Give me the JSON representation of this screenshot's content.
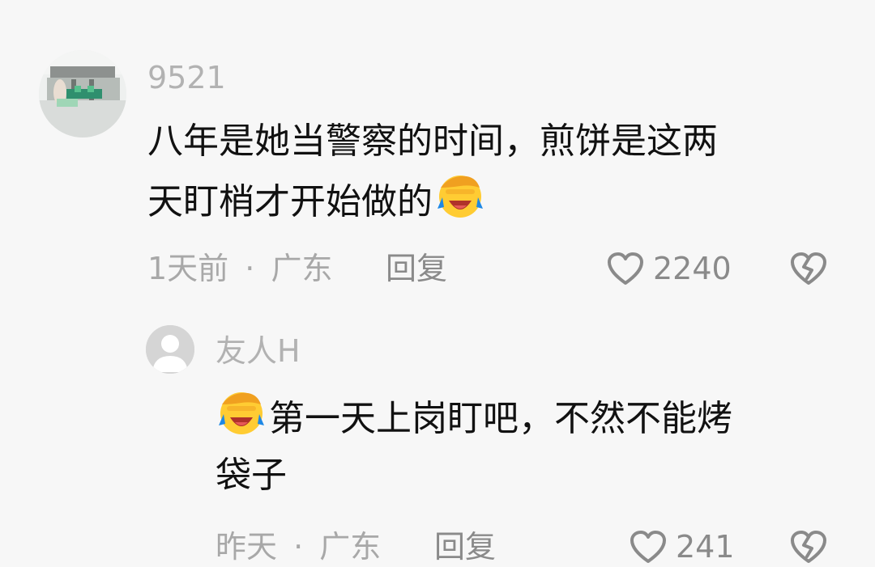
{
  "comments": [
    {
      "username": "9521",
      "text_line1": "八年是她当警察的时间，煎饼是这两",
      "text_line2": "天盯梢才开始做的",
      "time": "1天前",
      "separator": "·",
      "location": "广东",
      "reply_label": "回复",
      "likes": "2240",
      "avatar_icon": "scene-photo-avatar",
      "emoji_icon": "facepalm-crying-emoji"
    },
    {
      "username": "友人H",
      "text_line1": "第一天上岗盯吧，不然不能烤",
      "text_line2": "袋子",
      "time": "昨天",
      "separator": "·",
      "location": "广东",
      "reply_label": "回复",
      "likes": "241",
      "avatar_icon": "default-user-avatar",
      "emoji_icon": "facepalm-crying-emoji"
    }
  ],
  "icons": {
    "like": "heart-outline-icon",
    "dislike": "broken-heart-icon"
  },
  "colors": {
    "background": "#f7f7f7",
    "primary_text": "#111111",
    "muted_text": "#a8a8a8",
    "action_text": "#8a8a8a",
    "emoji_yellow": "#ffcc33",
    "emoji_tears": "#1e88e5"
  }
}
